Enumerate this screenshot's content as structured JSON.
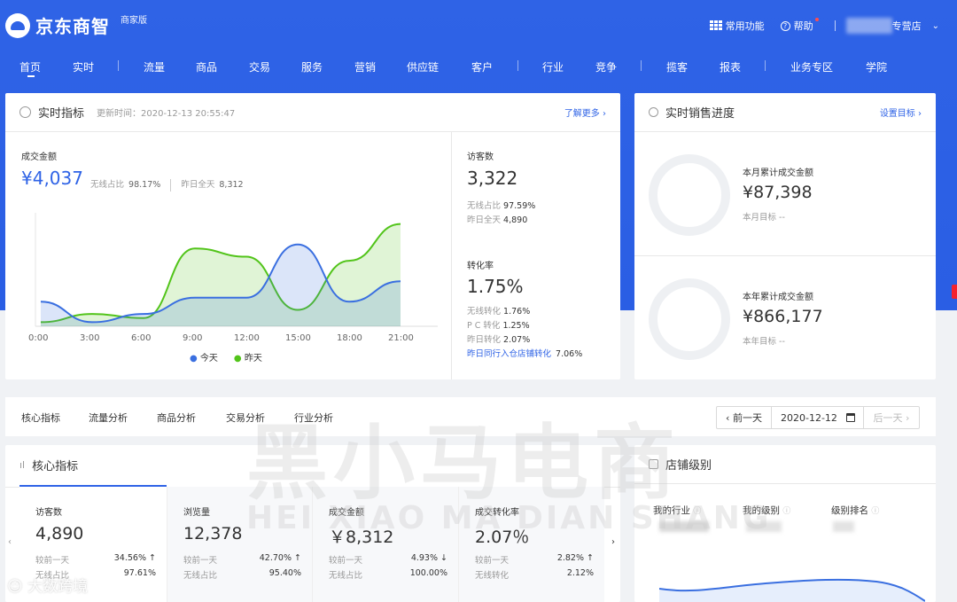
{
  "brand": {
    "name": "京东商智",
    "edition": "商家版"
  },
  "top_actions": {
    "common": "常用功能",
    "help": "帮助",
    "store_suffix": "专营店"
  },
  "nav": [
    "首页",
    "实时",
    "流量",
    "商品",
    "交易",
    "服务",
    "营销",
    "供应链",
    "客户",
    "行业",
    "竞争",
    "揽客",
    "报表",
    "业务专区",
    "学院"
  ],
  "realtime": {
    "title": "实时指标",
    "update_time": "更新时间：2020-12-13 20:55:47",
    "more": "了解更多",
    "gmv_label": "成交金额",
    "gmv": "¥4,037",
    "wireless_label": "无线占比",
    "wireless": "98.17%",
    "yesterday_label": "昨日全天",
    "yesterday": "8,312",
    "x_ticks": [
      "0:00",
      "3:00",
      "6:00",
      "9:00",
      "12:00",
      "15:00",
      "18:00",
      "21:00"
    ],
    "legend": [
      "今天",
      "昨天"
    ],
    "visitors_label": "访客数",
    "visitors": "3,322",
    "visitors_wireless_label": "无线占比",
    "visitors_wireless": "97.59%",
    "visitors_yesterday_label": "昨日全天",
    "visitors_yesterday": "4,890",
    "conv_label": "转化率",
    "conv": "1.75%",
    "conv_rows": [
      {
        "label": "无线转化",
        "value": "1.76%"
      },
      {
        "label": "P C 转化",
        "value": "1.25%"
      },
      {
        "label": "昨日转化",
        "value": "2.07%"
      }
    ],
    "industry_label": "昨日同行入仓店铺转化",
    "industry_value": "7.06%"
  },
  "sales_progress": {
    "title": "实时销售进度",
    "set_target": "设置目标",
    "month_label": "本月累计成交金额",
    "month_value": "¥87,398",
    "month_target": "本月目标 --",
    "year_label": "本年累计成交金额",
    "year_value": "¥866,177",
    "year_target": "本年目标 --"
  },
  "tabs": [
    "核心指标",
    "流量分析",
    "商品分析",
    "交易分析",
    "行业分析"
  ],
  "date_nav": {
    "prev": "‹ 前一天",
    "date": "2020-12-12",
    "next": "后一天 ›"
  },
  "core": {
    "title": "核心指标",
    "cells": [
      {
        "label": "访客数",
        "value": "4,890",
        "cmp_label": "较前一天",
        "cmp": "34.56%",
        "dir": "up",
        "sub_label": "无线占比",
        "sub": "97.61%"
      },
      {
        "label": "浏览量",
        "value": "12,378",
        "cmp_label": "较前一天",
        "cmp": "42.70%",
        "dir": "up",
        "sub_label": "无线占比",
        "sub": "95.40%"
      },
      {
        "label": "成交金额",
        "value": "￥8,312",
        "cmp_label": "较前一天",
        "cmp": "4.93%",
        "dir": "down",
        "sub_label": "无线占比",
        "sub": "100.00%"
      },
      {
        "label": "成交转化率",
        "value": "2.07％",
        "cmp_label": "较前一天",
        "cmp": "2.82%",
        "dir": "up",
        "sub_label": "无线转化",
        "sub": "2.12%"
      }
    ]
  },
  "store_level": {
    "title": "店铺级别",
    "cols": [
      "我的行业",
      "我的级别",
      "级别排名"
    ]
  },
  "watermark": {
    "main": "黑小马电商",
    "pinyin": "HEI XIAO MA DIAN SHANG",
    "corner": "大数跨境"
  },
  "chart_data": {
    "type": "line",
    "x": [
      "0:00",
      "3:00",
      "6:00",
      "9:00",
      "12:00",
      "15:00",
      "18:00",
      "21:00"
    ],
    "series": [
      {
        "name": "今天",
        "color": "#3a6fe0",
        "values": [
          0.3,
          0.05,
          0.15,
          0.35,
          0.35,
          1.0,
          0.3,
          0.55
        ]
      },
      {
        "name": "昨天",
        "color": "#52c41a",
        "values": [
          0.05,
          0.15,
          0.1,
          0.95,
          0.85,
          0.2,
          0.8,
          1.25
        ]
      }
    ]
  }
}
